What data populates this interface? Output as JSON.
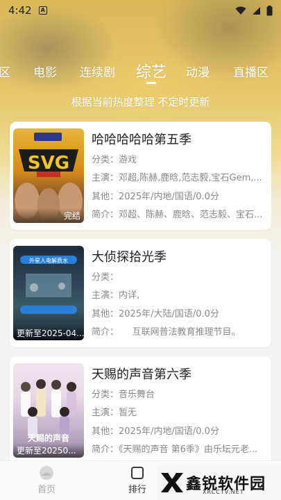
{
  "status_bar": {
    "time": "4:42",
    "notification": "A"
  },
  "tabs": [
    {
      "label": "区"
    },
    {
      "label": "电影"
    },
    {
      "label": "连续剧"
    },
    {
      "label": "综艺"
    },
    {
      "label": "动漫"
    },
    {
      "label": "直播区"
    }
  ],
  "active_tab": "综艺",
  "subtitle": "根据当前热度整理 不定时更新",
  "list": [
    {
      "title": "哈哈哈哈哈第五季",
      "category_label": "分类：",
      "category": "游戏",
      "cast_label": "主演：",
      "cast": "邓超,陈赫,鹿晗,范志毅,宝石Gem,...",
      "other_label": "其他：",
      "other": "2025年/内地/国语/0.0分",
      "intro_label": "简介：",
      "intro": "邓超、陈赫、鹿晗、范志毅、宝石...",
      "badge": "完结",
      "poster_text": "SVG"
    },
    {
      "title": "大侦探拾光季",
      "category_label": "分类：",
      "category": "",
      "cast_label": "主演：",
      "cast": "内详,",
      "other_label": "其他：",
      "other": "2025年/大陆/国语/0.0分",
      "intro_label": "简介：",
      "intro": "　　互联网普法教育推理节目。",
      "badge": "更新至2025-04...",
      "poster_text": "外星人电解质水"
    },
    {
      "title": "天赐的声音第六季",
      "category_label": "分类：",
      "category": "音乐舞台",
      "cast_label": "主演：",
      "cast": "暂无",
      "other_label": "其他：",
      "other": "2025年/内地/国语/0.0分",
      "intro_label": "简介：",
      "intro": "《天赐的声音 第6季》由乐坛元老...",
      "badge": "更新至20250...",
      "poster_text": "天赐的声音"
    }
  ],
  "bottom_nav": [
    {
      "label": "首页"
    },
    {
      "label": "排行"
    }
  ],
  "watermark": {
    "text": "鑫锐软件园",
    "sub": "XRCCTV.NET"
  }
}
